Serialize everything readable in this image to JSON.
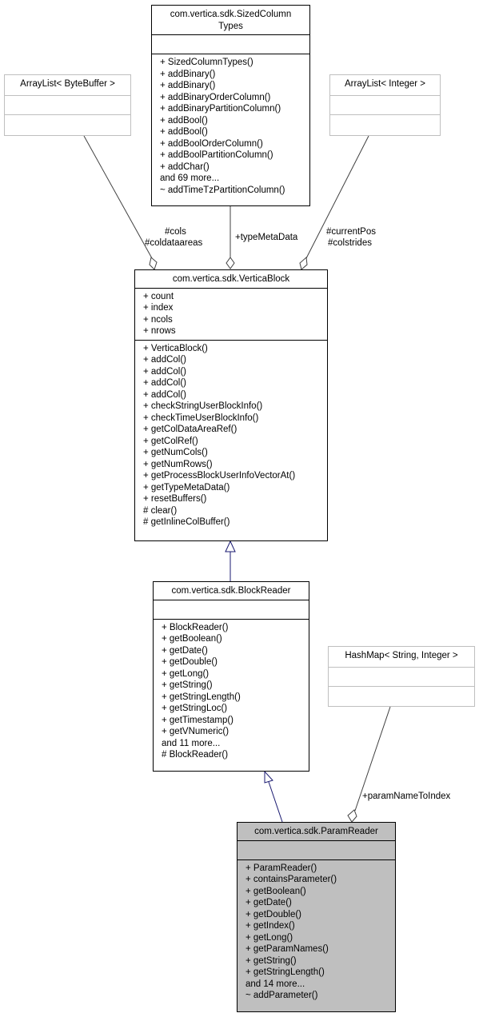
{
  "diagram": {
    "nodes": {
      "sized_column_types": {
        "title_line1": "com.vertica.sdk.SizedColumn",
        "title_line2": "Types",
        "attributes": [],
        "methods": [
          "+ SizedColumnTypes()",
          "+ addBinary()",
          "+ addBinary()",
          "+ addBinaryOrderColumn()",
          "+ addBinaryPartitionColumn()",
          "+ addBool()",
          "+ addBool()",
          "+ addBoolOrderColumn()",
          "+ addBoolPartitionColumn()",
          "+ addChar()",
          "and 69 more...",
          "~ addTimeTzPartitionColumn()"
        ]
      },
      "arraylist_bytebuffer": {
        "title": "ArrayList< ByteBuffer >"
      },
      "arraylist_integer": {
        "title": "ArrayList< Integer >"
      },
      "vertica_block": {
        "title": "com.vertica.sdk.VerticaBlock",
        "attributes": [
          "+ count",
          "+ index",
          "+ ncols",
          "+ nrows"
        ],
        "methods": [
          "+ VerticaBlock()",
          "+ addCol()",
          "+ addCol()",
          "+ addCol()",
          "+ addCol()",
          "+ checkStringUserBlockInfo()",
          "+ checkTimeUserBlockInfo()",
          "+ getColDataAreaRef()",
          "+ getColRef()",
          "+ getNumCols()",
          "+ getNumRows()",
          "+ getProcessBlockUserInfoVectorAt()",
          "+ getTypeMetaData()",
          "+ resetBuffers()",
          "# clear()",
          "# getInlineColBuffer()"
        ]
      },
      "block_reader": {
        "title": "com.vertica.sdk.BlockReader",
        "methods": [
          "+ BlockReader()",
          "+ getBoolean()",
          "+ getDate()",
          "+ getDouble()",
          "+ getLong()",
          "+ getString()",
          "+ getStringLength()",
          "+ getStringLoc()",
          "+ getTimestamp()",
          "+ getVNumeric()",
          "and 11 more...",
          "# BlockReader()"
        ]
      },
      "hashmap": {
        "title": "HashMap< String, Integer >"
      },
      "param_reader": {
        "title": "com.vertica.sdk.ParamReader",
        "methods": [
          "+ ParamReader()",
          "+ containsParameter()",
          "+ getBoolean()",
          "+ getDate()",
          "+ getDouble()",
          "+ getIndex()",
          "+ getLong()",
          "+ getParamNames()",
          "+ getString()",
          "+ getStringLength()",
          "and 14 more...",
          "~ addParameter()"
        ]
      }
    },
    "edge_labels": {
      "cols": "#cols",
      "coldataareas": "#coldataareas",
      "type_meta_data": "+typeMetaData",
      "current_pos": "#currentPos",
      "colstrides": "#colstrides",
      "param_name_to_index": "+paramNameToIndex"
    },
    "colors": {
      "inheritance_edge": "#191970",
      "association_edge": "#404040",
      "focus_fill": "#bfbfbf",
      "external_border": "#bfbfbf"
    }
  }
}
